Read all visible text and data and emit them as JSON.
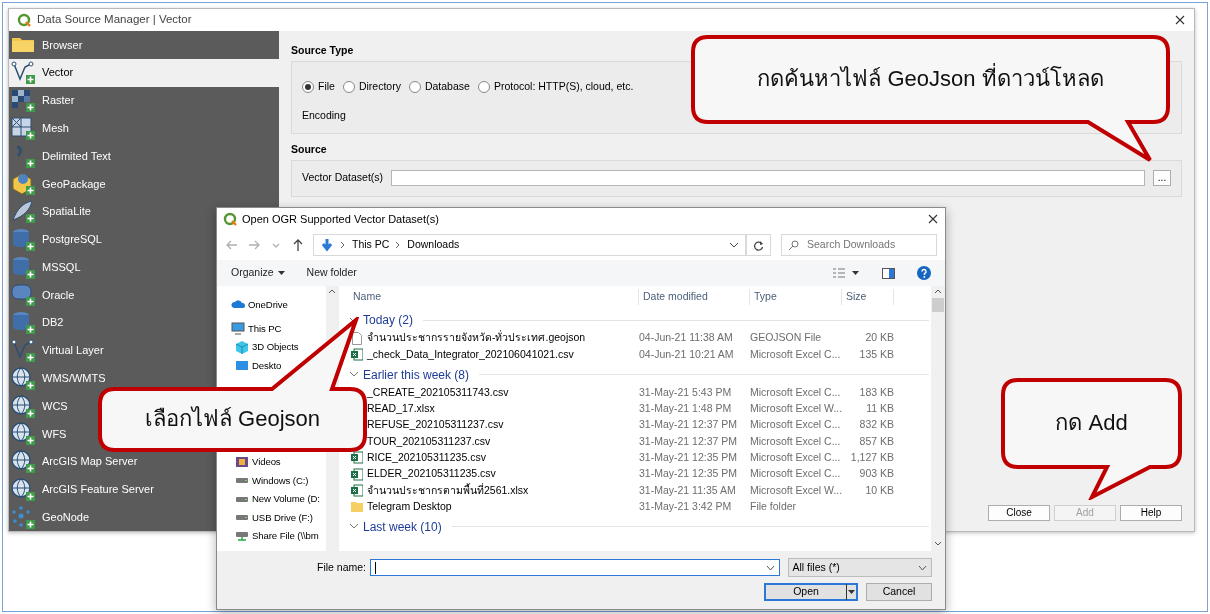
{
  "main_window": {
    "title": "Data Source Manager | Vector",
    "sidebar": {
      "items": [
        {
          "label": "Browser",
          "kind": "folder",
          "selected": false
        },
        {
          "label": "Vector",
          "kind": "vector",
          "selected": true
        },
        {
          "label": "Raster",
          "kind": "raster",
          "selected": false
        },
        {
          "label": "Mesh",
          "kind": "mesh",
          "selected": false
        },
        {
          "label": "Delimited Text",
          "kind": "text",
          "selected": false
        },
        {
          "label": "GeoPackage",
          "kind": "package",
          "selected": false
        },
        {
          "label": "SpatiaLite",
          "kind": "feather",
          "selected": false
        },
        {
          "label": "PostgreSQL",
          "kind": "database",
          "selected": false
        },
        {
          "label": "MSSQL",
          "kind": "database",
          "selected": false
        },
        {
          "label": "Oracle",
          "kind": "capsule",
          "selected": false
        },
        {
          "label": "DB2",
          "kind": "database",
          "selected": false
        },
        {
          "label": "Virtual Layer",
          "kind": "vector",
          "selected": false
        },
        {
          "label": "WMS/WMTS",
          "kind": "globe",
          "selected": false
        },
        {
          "label": "WCS",
          "kind": "globe",
          "selected": false
        },
        {
          "label": "WFS",
          "kind": "globe",
          "selected": false
        },
        {
          "label": "ArcGIS Map Server",
          "kind": "globe",
          "selected": false
        },
        {
          "label": "ArcGIS Feature Server",
          "kind": "globe",
          "selected": false
        },
        {
          "label": "GeoNode",
          "kind": "dots",
          "selected": false
        }
      ]
    },
    "source_type": {
      "heading": "Source Type",
      "options": [
        {
          "label": "File",
          "selected": true
        },
        {
          "label": "Directory",
          "selected": false
        },
        {
          "label": "Database",
          "selected": false
        },
        {
          "label": "Protocol: HTTP(S), cloud, etc.",
          "selected": false
        }
      ],
      "encoding_label": "Encoding"
    },
    "source": {
      "heading": "Source",
      "dataset_label": "Vector Dataset(s)",
      "browse_button": "..."
    },
    "buttons": [
      {
        "label": "Close",
        "disabled": false
      },
      {
        "label": "Add",
        "disabled": true
      },
      {
        "label": "Help",
        "disabled": false
      }
    ]
  },
  "file_dialog": {
    "title": "Open OGR Supported Vector Dataset(s)",
    "breadcrumb": [
      "This PC",
      "Downloads"
    ],
    "search": {
      "placeholder": "Search Downloads"
    },
    "toolbar": [
      "Organize",
      "New folder"
    ],
    "nav_items": [
      {
        "label": "OneDrive",
        "kind": "cloud"
      },
      {
        "label": "This PC",
        "kind": "pc"
      },
      {
        "label": "3D Objects",
        "kind": "cube"
      },
      {
        "label": "Deskto",
        "kind": "desktop"
      },
      {
        "label": "Videos",
        "kind": "videos"
      },
      {
        "label": "Windows (C:)",
        "kind": "drive"
      },
      {
        "label": "New Volume (D:",
        "kind": "drive"
      },
      {
        "label": "USB Drive (F:)",
        "kind": "drive"
      },
      {
        "label": "Share File (\\\\bm",
        "kind": "network"
      }
    ],
    "columns": [
      "Name",
      "Date modified",
      "Type",
      "Size"
    ],
    "groups": [
      {
        "label": "Today (2)",
        "rows": [
          {
            "name": "จำนวนประชากรรายจังหวัด-ทั่วประเทศ.geojson",
            "date": "04-Jun-21 11:38 AM",
            "type": "GEOJSON File",
            "size": "20 KB",
            "kind": "document"
          },
          {
            "name": "_check_Data_Integrator_202106041021.csv",
            "date": "04-Jun-21 10:21 AM",
            "type": "Microsoft Excel C...",
            "size": "135 KB",
            "kind": "excel"
          }
        ]
      },
      {
        "label": "Earlier this week (8)",
        "rows": [
          {
            "name": "_CREATE_202105311743.csv",
            "date": "31-May-21 5:43 PM",
            "type": "Microsoft Excel C...",
            "size": "183 KB"
          },
          {
            "name": "READ_17.xlsx",
            "date": "31-May-21 1:48 PM",
            "type": "Microsoft Excel W...",
            "size": "11 KB"
          },
          {
            "name": "REFUSE_202105311237.csv",
            "date": "31-May-21 12:37 PM",
            "type": "Microsoft Excel C...",
            "size": "832 KB"
          },
          {
            "name": "TOUR_202105311237.csv",
            "date": "31-May-21 12:37 PM",
            "type": "Microsoft Excel C...",
            "size": "857 KB"
          },
          {
            "name": "RICE_202105311235.csv",
            "date": "31-May-21 12:35 PM",
            "type": "Microsoft Excel C...",
            "size": "1,127 KB",
            "kind": "excel"
          },
          {
            "name": "ELDER_202105311235.csv",
            "date": "31-May-21 12:35 PM",
            "type": "Microsoft Excel C...",
            "size": "903 KB",
            "kind": "excel"
          },
          {
            "name": "จำนวนประชากรตามพื้นที่2561.xlsx",
            "date": "31-May-21 11:35 AM",
            "type": "Microsoft Excel W...",
            "size": "10 KB",
            "kind": "excel"
          },
          {
            "name": "Telegram Desktop",
            "date": "31-May-21 3:42 PM",
            "type": "File folder",
            "kind": "folder"
          }
        ]
      },
      {
        "label": "Last week (10)"
      }
    ],
    "file_name_label": "File name:",
    "file_type": "All files (*)",
    "buttons": [
      "Open",
      "Cancel"
    ]
  },
  "callouts": [
    {
      "text": "กดค้นหาไฟล์ GeoJson ที่ดาวน์โหลด"
    },
    {
      "text": "เลือกไฟล์ Geojson"
    },
    {
      "text": "กด Add"
    }
  ]
}
